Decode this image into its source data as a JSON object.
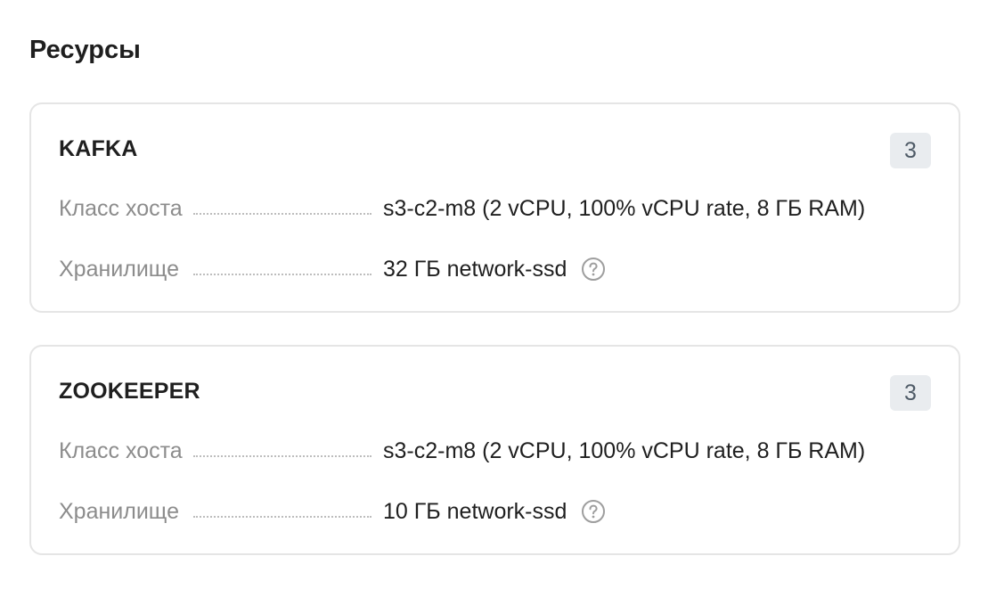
{
  "section": {
    "title": "Ресурсы"
  },
  "cards": [
    {
      "title": "KAFKA",
      "count": "3",
      "rows": [
        {
          "label": "Класс хоста",
          "value": "s3-c2-m8 (2 vCPU, 100% vCPU rate, 8 ГБ RAM)"
        },
        {
          "label": "Хранилище",
          "value": "32 ГБ network-ssd",
          "icon": "question-circle-icon"
        }
      ]
    },
    {
      "title": "ZOOKEEPER",
      "count": "3",
      "rows": [
        {
          "label": "Класс хоста",
          "value": "s3-c2-m8 (2 vCPU, 100% vCPU rate, 8 ГБ RAM)"
        },
        {
          "label": "Хранилище",
          "value": "10 ГБ network-ssd",
          "icon": "question-circle-icon"
        }
      ]
    }
  ],
  "colors": {
    "label_text": "#8c8c8c",
    "value_text": "#1f1f1f",
    "badge_bg": "#e9ecef",
    "badge_text": "#4e5a66",
    "card_border": "#e5e5e5",
    "icon": "#9e9e9e"
  }
}
